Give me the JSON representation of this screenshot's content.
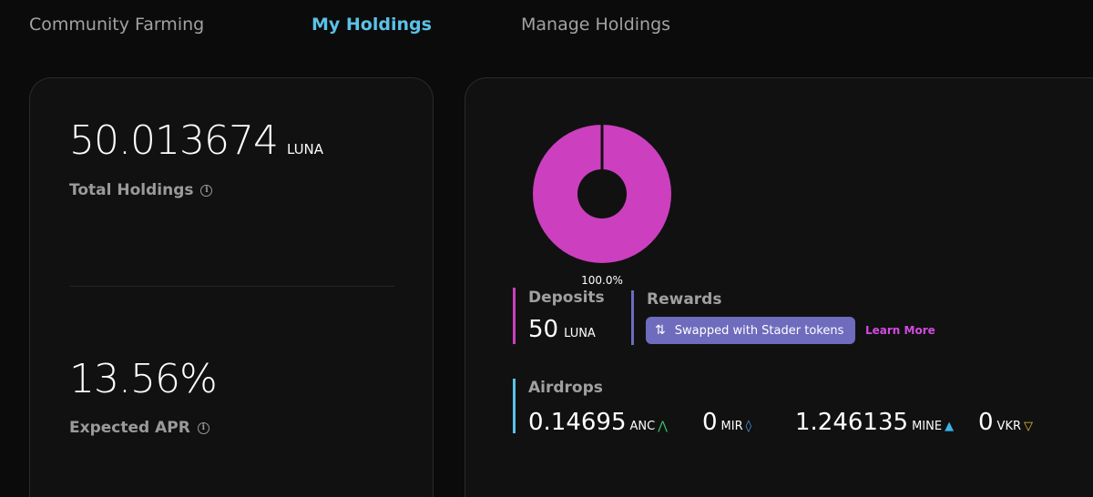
{
  "tabs": [
    {
      "label": "Community Farming"
    },
    {
      "label": "My Holdings"
    },
    {
      "label": "Manage Holdings"
    }
  ],
  "holdings": {
    "total_value": "50.013674",
    "total_unit": "LUNA",
    "total_label": "Total Holdings",
    "apr_value": "13.56%",
    "apr_label": "Expected APR"
  },
  "pie": {
    "percent_label": "100.0%",
    "color": "#cc3fbf"
  },
  "deposits": {
    "title": "Deposits",
    "value": "50",
    "unit": "LUNA",
    "bar_color": "#cc3fbf"
  },
  "rewards": {
    "title": "Rewards",
    "swap_label": "Swapped with Stader tokens",
    "learn_more": "Learn More",
    "bar_color": "#6f6bbd"
  },
  "airdrops": {
    "title": "Airdrops",
    "bar_color": "#5bc2e7",
    "items": [
      {
        "value": "0.14695",
        "unit": "ANC",
        "icon": "anc-icon",
        "color": "#3ec56a"
      },
      {
        "value": "0",
        "unit": "MIR",
        "icon": "mir-icon",
        "color": "#4a9fe8"
      },
      {
        "value": "1.246135",
        "unit": "MINE",
        "icon": "mine-icon",
        "color": "#3bb4e8"
      },
      {
        "value": "0",
        "unit": "VKR",
        "icon": "vkr-icon",
        "color": "#e8c23b"
      }
    ]
  },
  "colors": {
    "accent": "#5bc2e7",
    "background": "#0b0b0b",
    "card": "#111111",
    "link": "#d24be0"
  }
}
